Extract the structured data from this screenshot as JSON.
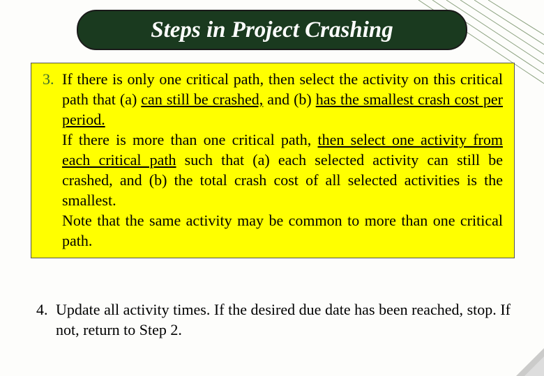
{
  "title": "Steps in Project Crashing",
  "step3": {
    "number": "3.",
    "p1a": "If there is only one critical path, then select the activity on this critical path that (a) ",
    "p1u1": "can still be crashed,",
    "p1b": " and (b) ",
    "p1u2": "has the smallest crash cost per period.",
    "p2a": "If there is more than one critical path, ",
    "p2u": "then select one activity from each critical path",
    "p2b": " such that (a) each selected activity can still be crashed, and (b) the total crash cost of all selected activities is the smallest.",
    "p3": "Note that the same activity may be common to more than one critical path."
  },
  "step4": {
    "number": "4.",
    "text": "Update all activity times. If the desired due date has been reached, stop. If not, return to Step 2."
  }
}
